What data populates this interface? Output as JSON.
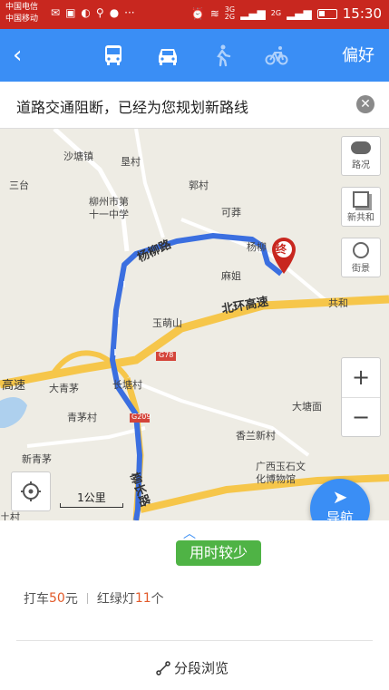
{
  "status": {
    "carrier1": "中国电信",
    "carrier2": "中国移动",
    "net_top": "3G",
    "net_bottom": "2G",
    "net2": "2G",
    "time": "15:30"
  },
  "header": {
    "back_icon": "back-arrow-icon",
    "modes": [
      {
        "name": "bus",
        "icon": "bus-icon"
      },
      {
        "name": "car",
        "icon": "car-icon",
        "selected": true
      },
      {
        "name": "walk",
        "icon": "walk-icon"
      },
      {
        "name": "bike",
        "icon": "bike-icon"
      }
    ],
    "preference_label": "偏好",
    "color": "#3a8ef5"
  },
  "notice": {
    "text": "道路交通阻断，已经为您规划新路线",
    "close_icon": "close-icon"
  },
  "map": {
    "labels": {
      "shatang": "沙塘镇",
      "kencun": "垦村",
      "santai": "三台",
      "guocun": "郭村",
      "school": "柳州市第\n十一中学",
      "kemang": "可莽",
      "xingonghe": "新共和",
      "yangliu_road": "杨柳路",
      "yangliu": "杨柳",
      "majie": "麻姐",
      "yumengshan": "玉萌山",
      "beihuan": "北环高速",
      "gonghe": "共和",
      "g78": "G78",
      "gaosu": "高速",
      "daqingmao": "大青茅",
      "changtangcun": "长塘村",
      "g209": "G209",
      "qingmaocun": "青茅村",
      "datangmian": "大塘面",
      "xianglan": "香兰新村",
      "xinqingmao": "新青茅",
      "museum": "广西玉石文\n化博物馆",
      "liuchang_road": "柳长路",
      "tucun": "土村",
      "end_marker": "终"
    },
    "side_buttons": {
      "traffic": "路况",
      "layers": "新共和",
      "panorama": "街景"
    },
    "zoom_in": "+",
    "zoom_out": "−",
    "scale": "1公里",
    "route_color": "#3b6fe0"
  },
  "navigate": {
    "label": "导航"
  },
  "panel": {
    "time_tag": "用时较少",
    "taxi_prefix": "打车",
    "taxi_price": "50",
    "taxi_unit": "元",
    "lights_prefix": "红绿灯",
    "lights_count": "11",
    "lights_unit": "个",
    "segment_label": "分段浏览"
  }
}
